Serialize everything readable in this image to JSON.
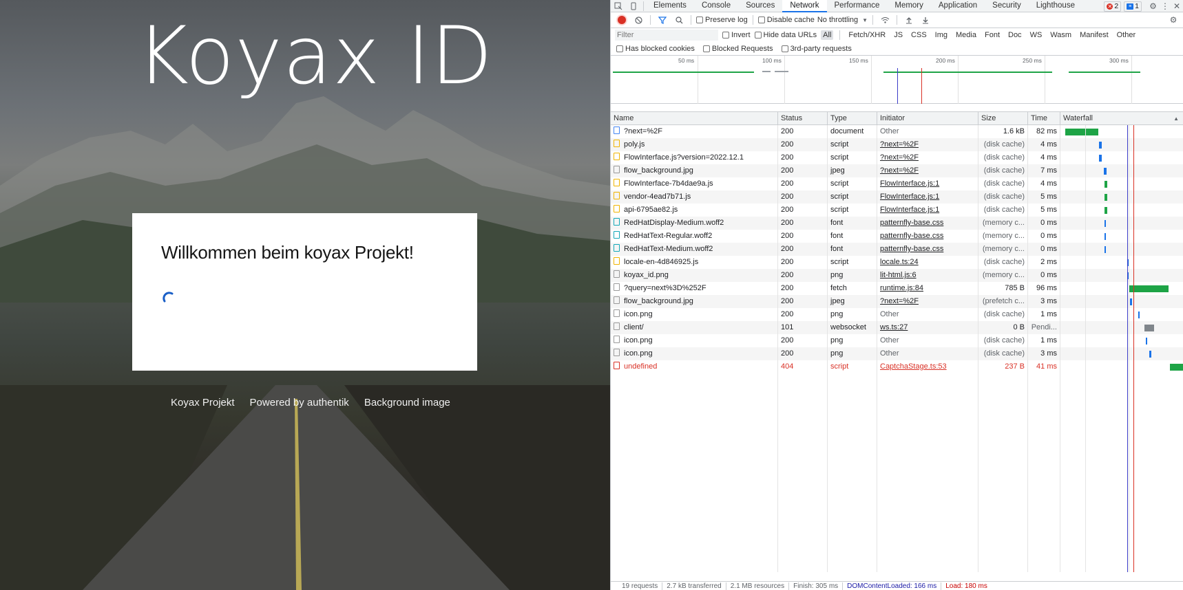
{
  "page": {
    "brand": "Koyax ID",
    "card_title": "Willkommen beim koyax Projekt!",
    "footer_links": [
      "Koyax Projekt",
      "Powered by authentik",
      "Background image"
    ]
  },
  "devtools": {
    "tabs": [
      "Elements",
      "Console",
      "Sources",
      "Network",
      "Performance",
      "Memory",
      "Application",
      "Security",
      "Lighthouse"
    ],
    "active_tab": "Network",
    "error_count": "2",
    "message_count": "1",
    "toolbar": {
      "preserve_log": "Preserve log",
      "disable_cache": "Disable cache",
      "throttling": "No throttling"
    },
    "filter": {
      "placeholder": "Filter",
      "invert": "Invert",
      "hide_data_urls": "Hide data URLs",
      "types": [
        "All",
        "Fetch/XHR",
        "JS",
        "CSS",
        "Img",
        "Media",
        "Font",
        "Doc",
        "WS",
        "Wasm",
        "Manifest",
        "Other"
      ],
      "active_type": "All",
      "has_blocked_cookies": "Has blocked cookies",
      "blocked_requests": "Blocked Requests",
      "third_party": "3rd-party requests"
    },
    "overview_ticks": [
      "50 ms",
      "100 ms",
      "150 ms",
      "200 ms",
      "250 ms",
      "300 ms"
    ],
    "columns": [
      "Name",
      "Status",
      "Type",
      "Initiator",
      "Size",
      "Time",
      "Waterfall"
    ],
    "requests": [
      {
        "icon": "doc",
        "name": "?next=%2F",
        "status": "200",
        "type": "document",
        "initiator": "Other",
        "init_link": false,
        "size": "1.6 kB",
        "time": "82 ms",
        "wf_start": 0.04,
        "wf_len": 0.27,
        "wf_color": "#1ea446"
      },
      {
        "icon": "script",
        "name": "poly.js",
        "status": "200",
        "type": "script",
        "initiator": "?next=%2F",
        "init_link": true,
        "size": "(disk cache)",
        "time": "4 ms",
        "wf_start": 0.315,
        "wf_len": 0.02,
        "wf_color": "#1a73e8"
      },
      {
        "icon": "script",
        "name": "FlowInterface.js?version=2022.12.1",
        "status": "200",
        "type": "script",
        "initiator": "?next=%2F",
        "init_link": true,
        "size": "(disk cache)",
        "time": "4 ms",
        "wf_start": 0.315,
        "wf_len": 0.02,
        "wf_color": "#1a73e8"
      },
      {
        "icon": "img",
        "name": "flow_background.jpg",
        "status": "200",
        "type": "jpeg",
        "initiator": "?next=%2F",
        "init_link": true,
        "size": "(disk cache)",
        "time": "7 ms",
        "wf_start": 0.35,
        "wf_len": 0.025,
        "wf_color": "#1a73e8"
      },
      {
        "icon": "script",
        "name": "FlowInterface-7b4dae9a.js",
        "status": "200",
        "type": "script",
        "initiator": "FlowInterface.js:1",
        "init_link": true,
        "size": "(disk cache)",
        "time": "4 ms",
        "wf_start": 0.355,
        "wf_len": 0.02,
        "wf_color": "#1ea446"
      },
      {
        "icon": "script",
        "name": "vendor-4ead7b71.js",
        "status": "200",
        "type": "script",
        "initiator": "FlowInterface.js:1",
        "init_link": true,
        "size": "(disk cache)",
        "time": "5 ms",
        "wf_start": 0.355,
        "wf_len": 0.02,
        "wf_color": "#1ea446"
      },
      {
        "icon": "script",
        "name": "api-6795ae82.js",
        "status": "200",
        "type": "script",
        "initiator": "FlowInterface.js:1",
        "init_link": true,
        "size": "(disk cache)",
        "time": "5 ms",
        "wf_start": 0.355,
        "wf_len": 0.02,
        "wf_color": "#1ea446"
      },
      {
        "icon": "font",
        "name": "RedHatDisplay-Medium.woff2",
        "status": "200",
        "type": "font",
        "initiator": "patternfly-base.css",
        "init_link": true,
        "size": "(memory c...",
        "time": "0 ms",
        "wf_start": 0.36,
        "wf_len": 0.008,
        "wf_color": "#1a73e8"
      },
      {
        "icon": "font",
        "name": "RedHatText-Regular.woff2",
        "status": "200",
        "type": "font",
        "initiator": "patternfly-base.css",
        "init_link": true,
        "size": "(memory c...",
        "time": "0 ms",
        "wf_start": 0.36,
        "wf_len": 0.008,
        "wf_color": "#1a73e8"
      },
      {
        "icon": "font",
        "name": "RedHatText-Medium.woff2",
        "status": "200",
        "type": "font",
        "initiator": "patternfly-base.css",
        "init_link": true,
        "size": "(memory c...",
        "time": "0 ms",
        "wf_start": 0.36,
        "wf_len": 0.008,
        "wf_color": "#1a73e8"
      },
      {
        "icon": "script",
        "name": "locale-en-4d846925.js",
        "status": "200",
        "type": "script",
        "initiator": "locale.ts:24",
        "init_link": true,
        "size": "(disk cache)",
        "time": "2 ms",
        "wf_start": 0.55,
        "wf_len": 0.012,
        "wf_color": "#1a73e8"
      },
      {
        "icon": "img",
        "name": "koyax_id.png",
        "status": "200",
        "type": "png",
        "initiator": "lit-html.js:6",
        "init_link": true,
        "size": "(memory c...",
        "time": "0 ms",
        "wf_start": 0.55,
        "wf_len": 0.008,
        "wf_color": "#1a73e8"
      },
      {
        "icon": "img",
        "name": "?query=next%3D%252F",
        "status": "200",
        "type": "fetch",
        "initiator": "runtime.js:84",
        "init_link": true,
        "size": "785 B",
        "time": "96 ms",
        "wf_start": 0.56,
        "wf_len": 0.32,
        "wf_color": "#1ea446"
      },
      {
        "icon": "img",
        "name": "flow_background.jpg",
        "status": "200",
        "type": "jpeg",
        "initiator": "?next=%2F",
        "init_link": true,
        "size": "(prefetch c...",
        "time": "3 ms",
        "wf_start": 0.565,
        "wf_len": 0.015,
        "wf_color": "#1a73e8"
      },
      {
        "icon": "img",
        "name": "icon.png",
        "status": "200",
        "type": "png",
        "initiator": "Other",
        "init_link": false,
        "size": "(disk cache)",
        "time": "1 ms",
        "wf_start": 0.63,
        "wf_len": 0.01,
        "wf_color": "#1a73e8"
      },
      {
        "icon": "img",
        "name": "client/",
        "status": "101",
        "type": "websocket",
        "initiator": "ws.ts:27",
        "init_link": true,
        "size": "0 B",
        "time": "Pendi...",
        "wf_start": 0.68,
        "wf_len": 0.08,
        "wf_color": "#80868b"
      },
      {
        "icon": "img",
        "name": "icon.png",
        "status": "200",
        "type": "png",
        "initiator": "Other",
        "init_link": false,
        "size": "(disk cache)",
        "time": "1 ms",
        "wf_start": 0.69,
        "wf_len": 0.01,
        "wf_color": "#1a73e8"
      },
      {
        "icon": "img",
        "name": "icon.png",
        "status": "200",
        "type": "png",
        "initiator": "Other",
        "init_link": false,
        "size": "(disk cache)",
        "time": "3 ms",
        "wf_start": 0.72,
        "wf_len": 0.015,
        "wf_color": "#1a73e8"
      },
      {
        "icon": "err",
        "name": "undefined",
        "status": "404",
        "type": "script",
        "initiator": "CaptchaStage.ts:53",
        "init_link": true,
        "size": "237 B",
        "time": "41 ms",
        "wf_start": 0.89,
        "wf_len": 0.11,
        "wf_color": "#1ea446",
        "error": true
      }
    ],
    "status": {
      "requests": "19 requests",
      "transferred": "2.7 kB transferred",
      "resources": "2.1 MB resources",
      "finish": "Finish: 305 ms",
      "dcl": "DOMContentLoaded: 166 ms",
      "load": "Load: 180 ms"
    }
  }
}
